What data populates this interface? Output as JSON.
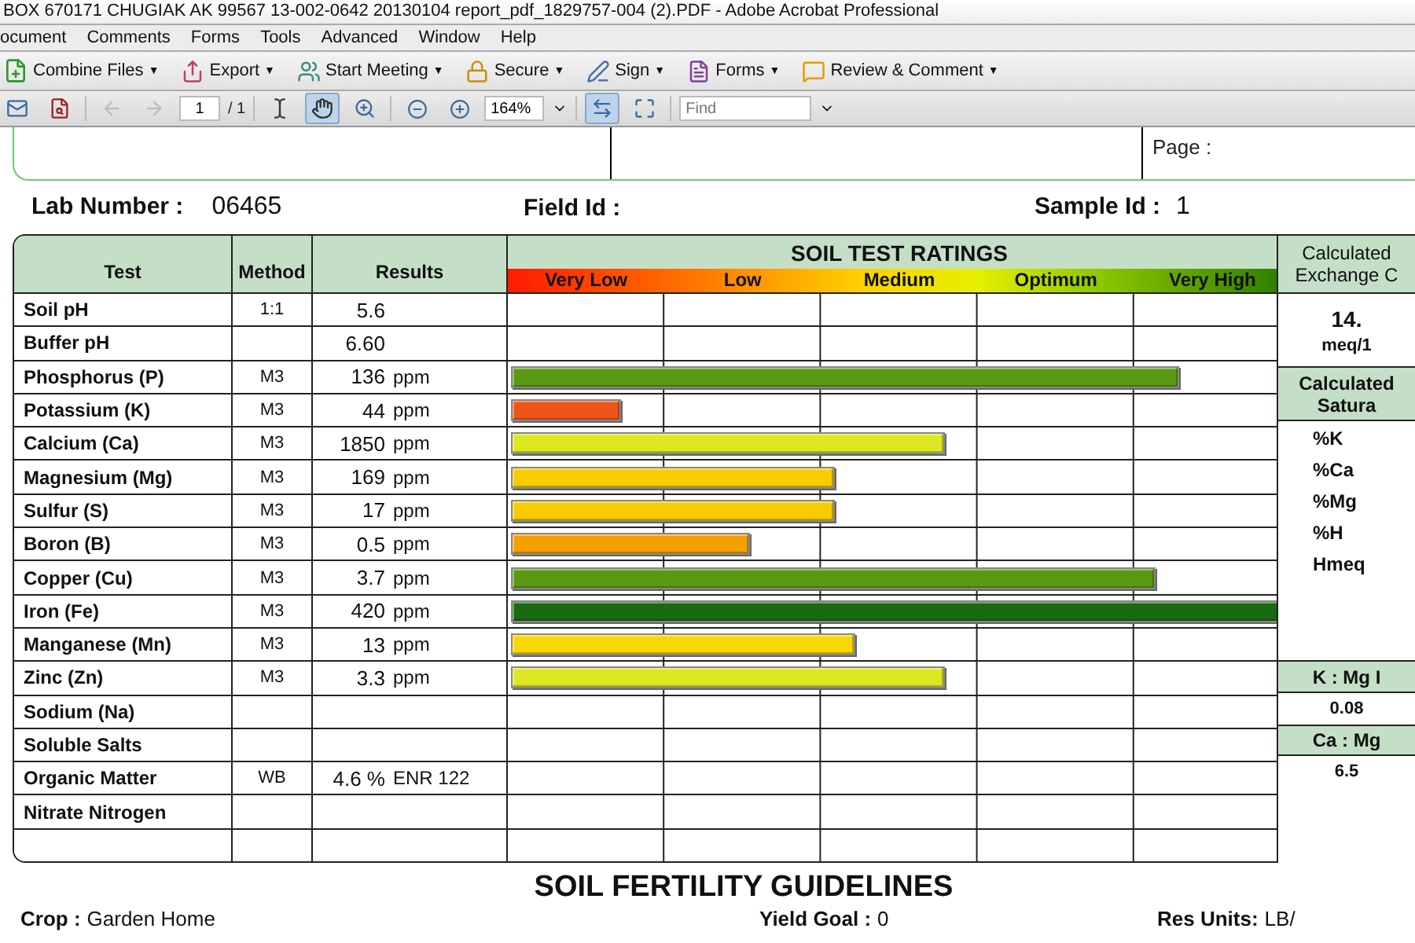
{
  "window": {
    "title": "BOX 670171 CHUGIAK AK 99567 13-002-0642 20130104 report_pdf_1829757-004 (2).PDF - Adobe Acrobat Professional"
  },
  "menu": [
    "ocument",
    "Comments",
    "Forms",
    "Tools",
    "Advanced",
    "Window",
    "Help"
  ],
  "task_buttons": [
    {
      "kind": "combine",
      "label": "Combine Files",
      "caret": "▼"
    },
    {
      "kind": "export",
      "label": "Export",
      "caret": "▼"
    },
    {
      "kind": "meeting",
      "label": "Start Meeting",
      "caret": "▼"
    },
    {
      "kind": "secure",
      "label": "Secure",
      "caret": "▼"
    },
    {
      "kind": "sign",
      "label": "Sign",
      "caret": "▼"
    },
    {
      "kind": "forms",
      "label": "Forms",
      "caret": "▼"
    },
    {
      "kind": "review",
      "label": "Review & Comment",
      "caret": "▼"
    }
  ],
  "nav": {
    "page": "1",
    "page_count": "/ 1",
    "zoom": "164%",
    "find_placeholder": "Find"
  },
  "tools": [
    {
      "kind": "select",
      "selected": false
    },
    {
      "kind": "hand",
      "selected": true
    },
    {
      "kind": "marquee",
      "selected": false
    }
  ],
  "views": [
    {
      "kind": "fitwidth",
      "selected": true
    },
    {
      "kind": "fullscreen",
      "selected": false
    }
  ],
  "report": {
    "page_label": "Page :",
    "fields": [
      {
        "label": "Lab Number :",
        "value": "06465"
      },
      {
        "label": "Field Id :"
      },
      {
        "label": "Sample Id :",
        "value": "1"
      }
    ],
    "columns": [
      "Test",
      "Method",
      "Results"
    ],
    "ratings_title": "SOIL TEST RATINGS",
    "scale": [
      "Very Low",
      "Low",
      "Medium",
      "Optimum",
      "Very High"
    ],
    "rows": [
      {
        "test": "Soil pH",
        "method": "1:1",
        "value": "5.6",
        "unit": ""
      },
      {
        "test": "Buffer pH",
        "method": "",
        "value": "6.60",
        "unit": ""
      },
      {
        "test": "Phosphorus (P)",
        "method": "M3",
        "value": "136",
        "unit": "ppm",
        "bar": {
          "level": 0.86,
          "color": "#5a9a12"
        }
      },
      {
        "test": "Potassium (K)",
        "method": "M3",
        "value": "44",
        "unit": "ppm",
        "bar": {
          "level": 0.145,
          "color": "#f05418"
        }
      },
      {
        "test": "Calcium (Ca)",
        "method": "M3",
        "value": "1850",
        "unit": "ppm",
        "bar": {
          "level": 0.56,
          "color": "#dde822"
        }
      },
      {
        "test": "Magnesium (Mg)",
        "method": "M3",
        "value": "169",
        "unit": "ppm",
        "bar": {
          "level": 0.42,
          "color": "#f8cc00"
        }
      },
      {
        "test": "Sulfur (S)",
        "method": "M3",
        "value": "17",
        "unit": "ppm",
        "bar": {
          "level": 0.42,
          "color": "#f8cc00"
        }
      },
      {
        "test": "Boron (B)",
        "method": "M3",
        "value": "0.5",
        "unit": "ppm",
        "bar": {
          "level": 0.31,
          "color": "#f4a000"
        }
      },
      {
        "test": "Copper (Cu)",
        "method": "M3",
        "value": "3.7",
        "unit": "ppm",
        "bar": {
          "level": 0.83,
          "color": "#5a9a12"
        }
      },
      {
        "test": "Iron (Fe)",
        "method": "M3",
        "value": "420",
        "unit": "ppm",
        "bar": {
          "level": 1.0,
          "color": "#1a6a10"
        }
      },
      {
        "test": "Manganese (Mn)",
        "method": "M3",
        "value": "13",
        "unit": "ppm",
        "bar": {
          "level": 0.445,
          "color": "#f8d800"
        }
      },
      {
        "test": "Zinc (Zn)",
        "method": "M3",
        "value": "3.3",
        "unit": "ppm",
        "bar": {
          "level": 0.56,
          "color": "#dde822"
        }
      },
      {
        "test": "Sodium (Na)",
        "method": "",
        "value": "",
        "unit": ""
      },
      {
        "test": "Soluble Salts",
        "method": "",
        "value": "",
        "unit": ""
      },
      {
        "test": "Organic Matter",
        "method": "WB",
        "value": "4.6 %",
        "unit": "ENR 122"
      },
      {
        "test": "Nitrate Nitrogen",
        "method": "",
        "value": "",
        "unit": ""
      },
      {
        "test": "",
        "method": "",
        "value": "",
        "unit": ""
      }
    ],
    "side": {
      "cec_title": [
        "Calculated",
        "Exchange C"
      ],
      "cec_value": "14.",
      "cec_unit": "meq/1",
      "sat_title": [
        "Calculated",
        "Satura"
      ],
      "sat_items": [
        "%K",
        "%Ca",
        "%Mg",
        "%H",
        "Hmeq"
      ],
      "kmg_title": "K : Mg I",
      "kmg_value": "0.08",
      "camg_title": "Ca : Mg",
      "camg_value": "6.5"
    },
    "guidelines_title": "SOIL FERTILITY GUIDELINES",
    "footer": [
      {
        "label": "Crop :",
        "value": "Garden Home"
      },
      {
        "label": "Yield Goal :",
        "value": "0"
      },
      {
        "label": "Res Units:",
        "value": "LB/"
      }
    ]
  }
}
